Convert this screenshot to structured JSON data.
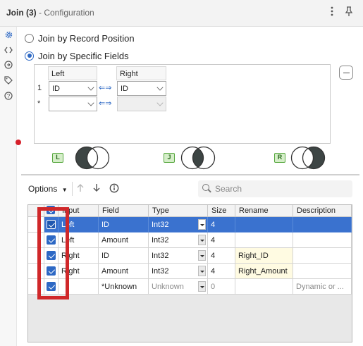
{
  "header": {
    "title": "Join (3)",
    "subtitle": " - Configuration",
    "more_icon": "vertical-ellipsis-icon",
    "pin_icon": "pin-icon"
  },
  "rail": {
    "icons": [
      "gear-icon",
      "code-icon",
      "arrow-circle-icon",
      "tag-icon",
      "help-icon"
    ],
    "status_dot_color": "#d6202a"
  },
  "join_options": {
    "by_position_label": "Join by Record Position",
    "by_fields_label": "Join by Specific Fields",
    "selected": "by_fields"
  },
  "join_grid": {
    "left_header": "Left",
    "right_header": "Right",
    "rows": [
      {
        "num": "1",
        "left": "ID",
        "right": "ID"
      },
      {
        "num": "*",
        "left": "",
        "right": ""
      }
    ]
  },
  "venn": [
    {
      "badge": "L",
      "part": "left"
    },
    {
      "badge": "J",
      "part": "inner"
    },
    {
      "badge": "R",
      "part": "right"
    }
  ],
  "toolbar": {
    "options_label": "Options",
    "search_placeholder": "Search"
  },
  "fields_table": {
    "columns": [
      "Input",
      "Field",
      "Type",
      "Size",
      "Rename",
      "Description"
    ],
    "rows": [
      {
        "checked": true,
        "input": "Left",
        "field": "ID",
        "type": "Int32",
        "size": "4",
        "rename": "",
        "description": "",
        "selected": true
      },
      {
        "checked": true,
        "input": "Left",
        "field": "Amount",
        "type": "Int32",
        "size": "4",
        "rename": "",
        "description": ""
      },
      {
        "checked": true,
        "input": "Right",
        "field": "ID",
        "type": "Int32",
        "size": "4",
        "rename": "Right_ID",
        "description": ""
      },
      {
        "checked": true,
        "input": "Right",
        "field": "Amount",
        "type": "Int32",
        "size": "4",
        "rename": "Right_Amount",
        "description": ""
      },
      {
        "checked": true,
        "input": "",
        "field": "*Unknown",
        "type": "Unknown",
        "size": "0",
        "rename": "",
        "description": "Dynamic or ..."
      }
    ]
  },
  "colors": {
    "accent": "#2d68c4",
    "selected_row": "#3a72cf",
    "rename_bg": "#fffbe2",
    "annotation": "#d0282a",
    "venn_fill": "#3d4544"
  }
}
